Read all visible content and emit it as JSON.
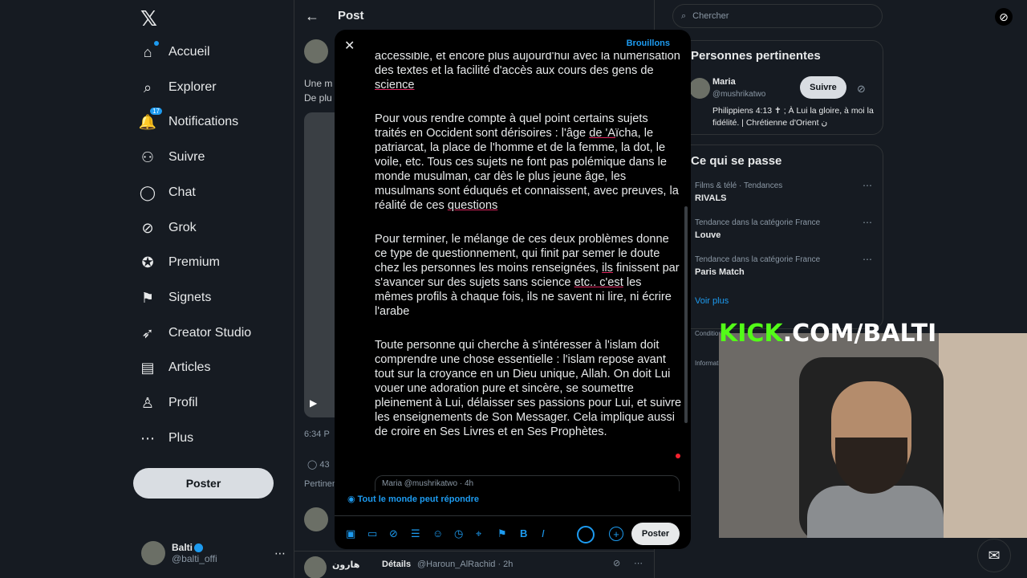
{
  "nav": {
    "items": [
      {
        "label": "Accueil",
        "icon": "home-icon",
        "glyph": "⌂"
      },
      {
        "label": "Explorer",
        "icon": "search-icon",
        "glyph": "⌕"
      },
      {
        "label": "Notifications",
        "icon": "bell-icon",
        "glyph": "🔔",
        "badge": "17"
      },
      {
        "label": "Suivre",
        "icon": "add-user-icon",
        "glyph": "⚇"
      },
      {
        "label": "Chat",
        "icon": "chat-icon",
        "glyph": "◯"
      },
      {
        "label": "Grok",
        "icon": "grok-icon",
        "glyph": "⊘"
      },
      {
        "label": "Premium",
        "icon": "premium-icon",
        "glyph": "✪"
      },
      {
        "label": "Signets",
        "icon": "bookmark-icon",
        "glyph": "⚑"
      },
      {
        "label": "Creator Studio",
        "icon": "rocket-icon",
        "glyph": "➶"
      },
      {
        "label": "Articles",
        "icon": "article-icon",
        "glyph": "▤"
      },
      {
        "label": "Profil",
        "icon": "profile-icon",
        "glyph": "♙"
      },
      {
        "label": "Plus",
        "icon": "more-icon",
        "glyph": "⋯"
      }
    ],
    "post_button": "Poster",
    "account": {
      "name": "Balti",
      "handle": "@balti_offi"
    }
  },
  "center": {
    "title": "Post",
    "line1": "Une m",
    "line2": "De plu",
    "time": "6:34 P",
    "stat": "43",
    "pertinent": "Pertinen",
    "reply_name": "هارون",
    "reply_details": "Détails",
    "reply_handle": "@Haroun_AlRachid · 2h"
  },
  "right": {
    "search_placeholder": "Chercher",
    "people_title": "Personnes pertinentes",
    "person": {
      "name": "Maria",
      "handle": "@mushrikatwo",
      "bio": "Philippiens 4:13 ✝ ; À Lui la gloire, à moi la fidélité. | Chrétienne d'Orient ن",
      "follow": "Suivre"
    },
    "happening_title": "Ce qui se passe",
    "trends": [
      {
        "meta": "Films & télé · Tendances",
        "name": "RIVALS"
      },
      {
        "meta": "Tendance dans la catégorie France",
        "name": "Louve"
      },
      {
        "meta": "Tendance dans la catégorie France",
        "name": "Paris Match"
      }
    ],
    "show_more": "Voir plus",
    "footer1": "Conditions",
    "footer2": "Informations"
  },
  "modal": {
    "drafts": "Brouillons",
    "para0_a": "accessible, et encore plus aujourd'hui avec la numérisation des textes et la facilité d'accès aux cours des gens de ",
    "para0_ul": "science",
    "para1_a": "Pour vous rendre compte à quel point certains sujets traités en Occident sont dérisoires : l'âge ",
    "para1_ul1": "de 'A",
    "para1_b": "ïcha, le patriarcat, la place de l'homme et de la femme, la dot, le voile, etc. Tous ces sujets ne font pas polémique dans le monde musulman, car dès le plus jeune âge, les musulmans sont éduqués et connaissent, avec preuves, la réalité de ces ",
    "para1_ul2": "questions",
    "para2_a": "Pour terminer, le mélange de ces deux problèmes donne ce type de questionnement, qui finit par semer le doute chez les personnes les moins renseignées, ",
    "para2_ul1": "ils",
    "para2_b": " finissent par s'avancer sur des sujets sans science ",
    "para2_ul2": "etc.. c'est",
    "para2_c": " les mêmes profils à chaque fois, ils ne savent ni lire, ni écrire l'arabe",
    "para3": "Toute personne qui cherche à s'intéresser à l'islam doit comprendre une chose essentielle : l'islam repose avant tout sur la croyance en un Dieu unique, Allah. On doit Lui vouer une adoration pure et sincère, se soumettre pleinement à Lui, délaisser ses passions pour Lui, et suivre les enseignements de Son Messager. Cela implique aussi de croire en Ses Livres et en Ses Prophètes.",
    "quote": "Maria  @mushrikatwo · 4h",
    "reply_setting": "Tout le monde peut répondre",
    "poster": "Poster"
  },
  "overlay": {
    "kick_brand": "KICK",
    "kick_rest": ".COM/BALTI"
  },
  "colors": {
    "accent": "#1d9bf0",
    "kick_green": "#53fc18",
    "background": "#000000"
  }
}
